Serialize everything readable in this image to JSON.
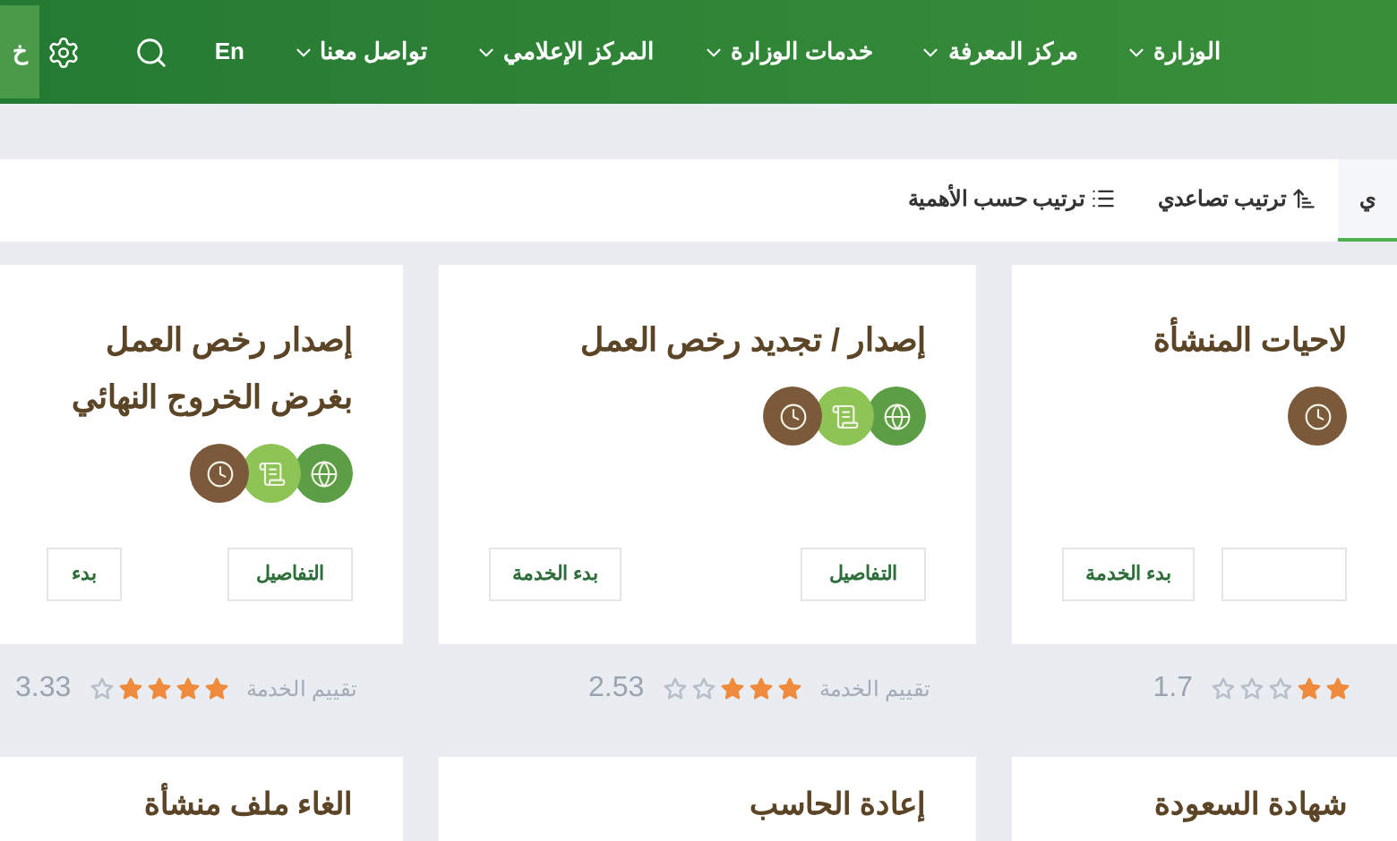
{
  "header": {
    "nav": [
      "الوزارة",
      "مركز المعرفة",
      "خدمات الوزارة",
      "المركز الإعلامي",
      "تواصل معنا"
    ],
    "language": "En",
    "edge_tab": "خ"
  },
  "sort_tabs": [
    {
      "label": "ي",
      "kind": "plain",
      "selected": true
    },
    {
      "label": "ترتيب تصاعدي",
      "kind": "ascending",
      "selected": false
    },
    {
      "label": "ترتيب حسب الأهمية",
      "kind": "list",
      "selected": false
    }
  ],
  "cards": [
    {
      "title": "لاحيات المنشأة",
      "channels": [
        {
          "kind": "time"
        }
      ],
      "buttons": [
        {
          "kind": "details"
        },
        {
          "kind": "start",
          "label": "بدء الخدمة"
        }
      ],
      "stars": 2,
      "score": "1.7"
    },
    {
      "title": "إصدار / تجديد رخص العمل",
      "channels": [
        {
          "kind": "web"
        },
        {
          "kind": "paper"
        },
        {
          "kind": "time"
        }
      ],
      "buttons": [
        {
          "kind": "details",
          "label": "التفاصيل"
        },
        {
          "kind": "start",
          "label": "بدء الخدمة"
        }
      ],
      "rating_label": "تقييم الخدمة",
      "stars": 3,
      "score": "2.53"
    },
    {
      "title": "إصدار رخص العمل بغرض الخروج النهائي",
      "channels": [
        {
          "kind": "web"
        },
        {
          "kind": "paper"
        },
        {
          "kind": "time"
        }
      ],
      "buttons": [
        {
          "kind": "details",
          "label": "التفاصيل"
        },
        {
          "kind": "start",
          "label": "بدء"
        }
      ],
      "rating_label": "تقييم الخدمة",
      "stars": 4,
      "score": "3.33"
    }
  ],
  "more_cards": [
    {
      "title": "شهادة السعودة"
    },
    {
      "title": "إعادة الحاسب"
    },
    {
      "title": "الغاء ملف منشأة"
    }
  ]
}
